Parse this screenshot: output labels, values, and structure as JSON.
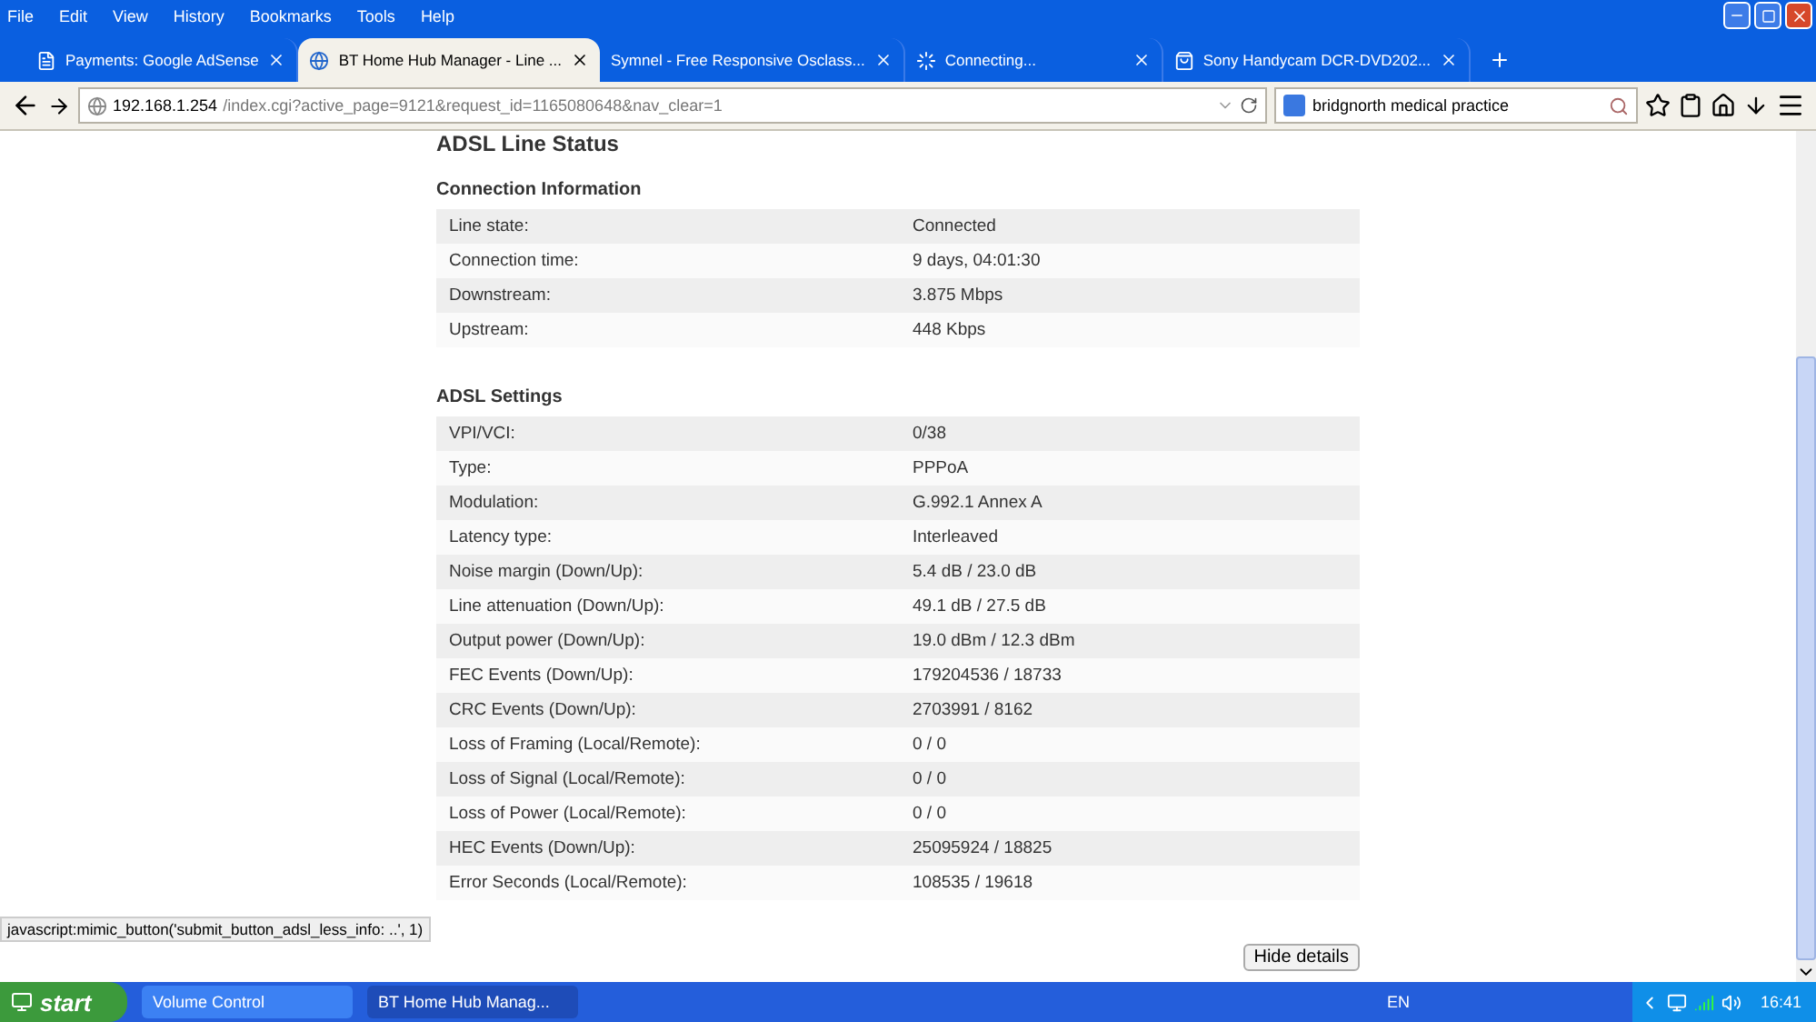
{
  "menu": [
    "File",
    "Edit",
    "View",
    "History",
    "Bookmarks",
    "Tools",
    "Help"
  ],
  "tabs": [
    {
      "title": "Payments: Google AdSense",
      "selected": false,
      "kind": "page"
    },
    {
      "title": "BT Home Hub Manager - Line ...",
      "selected": true,
      "kind": "globe"
    },
    {
      "title": "Symnel - Free Responsive Osclass...",
      "selected": false,
      "kind": "none"
    },
    {
      "title": "Connecting...",
      "selected": false,
      "kind": "loading"
    },
    {
      "title": "Sony Handycam DCR-DVD202...",
      "selected": false,
      "kind": "bag"
    }
  ],
  "address": {
    "host": "192.168.1.254",
    "path": "/index.cgi?active_page=9121&request_id=1165080648&nav_clear=1"
  },
  "search": {
    "value": "bridgnorth medical practice"
  },
  "page_title": "ADSL Line Status",
  "sections": [
    {
      "title": "Connection Information",
      "rows": [
        {
          "label": "Line state:",
          "value": "Connected"
        },
        {
          "label": "Connection time:",
          "value": "9 days, 04:01:30"
        },
        {
          "label": "Downstream:",
          "value": "3.875 Mbps"
        },
        {
          "label": "Upstream:",
          "value": "448 Kbps"
        }
      ]
    },
    {
      "title": "ADSL Settings",
      "rows": [
        {
          "label": "VPI/VCI:",
          "value": "0/38"
        },
        {
          "label": "Type:",
          "value": "PPPoA"
        },
        {
          "label": "Modulation:",
          "value": "G.992.1 Annex A"
        },
        {
          "label": "Latency type:",
          "value": "Interleaved"
        },
        {
          "label": "Noise margin (Down/Up):",
          "value": "5.4 dB / 23.0 dB"
        },
        {
          "label": "Line attenuation (Down/Up):",
          "value": "49.1 dB / 27.5 dB"
        },
        {
          "label": "Output power (Down/Up):",
          "value": "19.0 dBm / 12.3 dBm"
        },
        {
          "label": "FEC Events (Down/Up):",
          "value": "179204536 / 18733"
        },
        {
          "label": "CRC Events (Down/Up):",
          "value": "2703991 / 8162"
        },
        {
          "label": "Loss of Framing (Local/Remote):",
          "value": "0 / 0"
        },
        {
          "label": "Loss of Signal (Local/Remote):",
          "value": "0 / 0"
        },
        {
          "label": "Loss of Power (Local/Remote):",
          "value": "0 / 0"
        },
        {
          "label": "HEC Events (Down/Up):",
          "value": "25095924 / 18825"
        },
        {
          "label": "Error Seconds (Local/Remote):",
          "value": "108535 / 19618"
        }
      ]
    }
  ],
  "hide_button": "Hide details",
  "status_text": "javascript:mimic_button('submit_button_adsl_less_info: ..', 1)",
  "taskbar": {
    "start": "start",
    "tasks": [
      {
        "title": "Volume Control",
        "selected": false
      },
      {
        "title": "BT Home Hub Manag...",
        "selected": true
      }
    ],
    "language": "EN",
    "clock": "16:41"
  }
}
